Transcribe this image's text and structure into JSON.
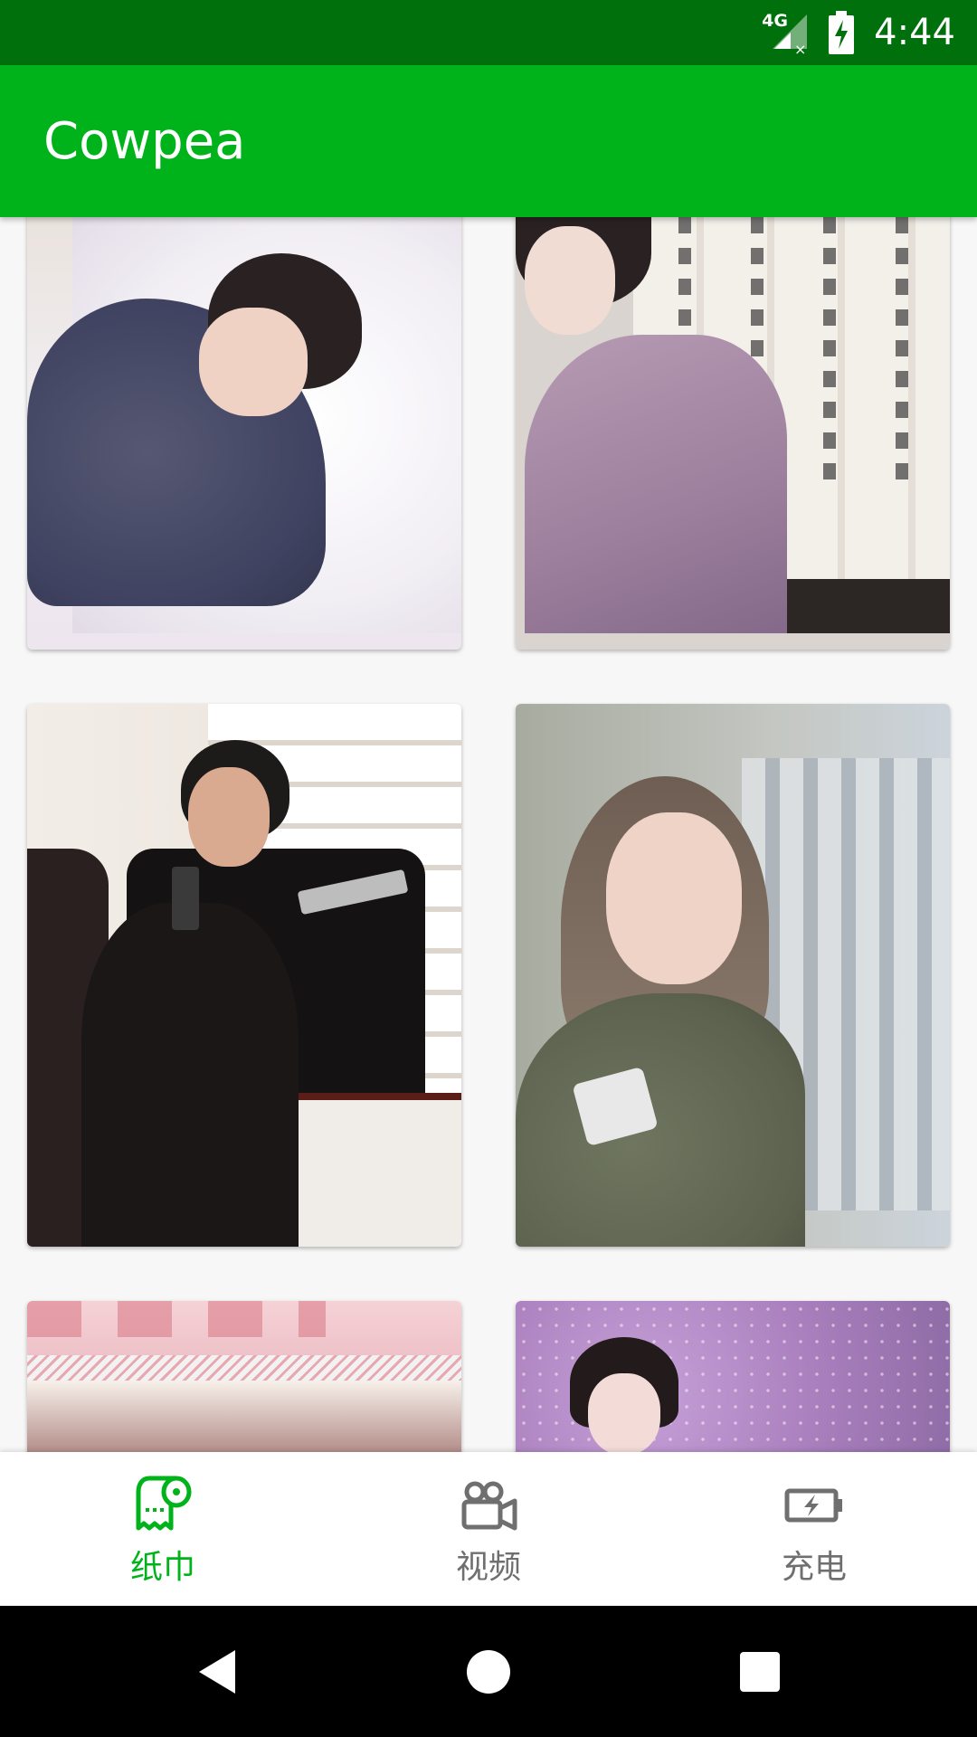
{
  "status_bar": {
    "network": "4G",
    "time": "4:44"
  },
  "app_bar": {
    "title": "Cowpea"
  },
  "grid": {
    "items": [
      {
        "icon": "photo-sleeping-girl"
      },
      {
        "icon": "photo-hanfu-girl"
      },
      {
        "icon": "photo-gun-pose"
      },
      {
        "icon": "photo-smiling-girl"
      },
      {
        "icon": "photo-shop-sign"
      },
      {
        "icon": "photo-twin-tails-girl"
      }
    ]
  },
  "bottom_nav": {
    "items": [
      {
        "label": "纸巾",
        "icon": "tissue-roll-icon",
        "active": true
      },
      {
        "label": "视频",
        "icon": "video-camera-icon",
        "active": false
      },
      {
        "label": "充电",
        "icon": "battery-charging-icon",
        "active": false
      }
    ]
  },
  "colors": {
    "status_bar": "#00700c",
    "app_bar": "#00b31a",
    "nav_active": "#00b31a",
    "nav_inactive": "#6f6f6f"
  }
}
